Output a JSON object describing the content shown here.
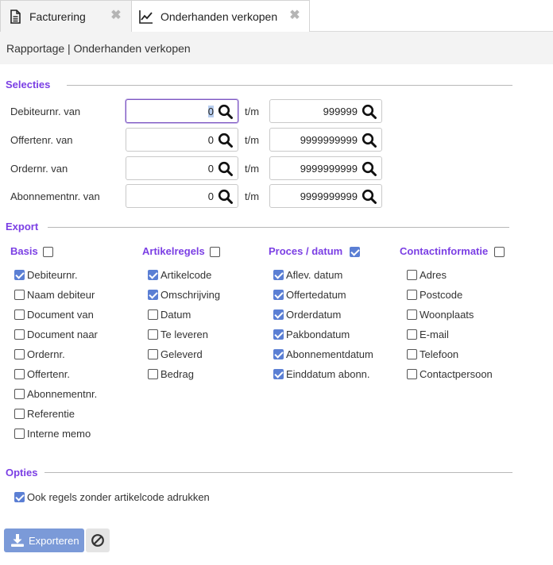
{
  "tabs": [
    {
      "label": "Facturering",
      "icon": "document-icon",
      "active": false
    },
    {
      "label": "Onderhanden verkopen",
      "icon": "line-chart-icon",
      "active": true
    }
  ],
  "breadcrumb": "Rapportage | Onderhanden verkopen",
  "selecties": {
    "title": "Selecties",
    "tm_label": "t/m",
    "rows": [
      {
        "label": "Debiteurnr. van",
        "from": "0",
        "to": "999999"
      },
      {
        "label": "Offertenr. van",
        "from": "0",
        "to": "9999999999"
      },
      {
        "label": "Ordernr. van",
        "from": "0",
        "to": "9999999999"
      },
      {
        "label": "Abonnementnr. van",
        "from": "0",
        "to": "9999999999"
      }
    ]
  },
  "export": {
    "title": "Export",
    "groups": [
      {
        "title": "Basis",
        "checked": false,
        "items": [
          {
            "label": "Debiteurnr.",
            "checked": true
          },
          {
            "label": "Naam debiteur",
            "checked": false
          },
          {
            "label": "Document van",
            "checked": false
          },
          {
            "label": "Document naar",
            "checked": false
          },
          {
            "label": "Ordernr.",
            "checked": false
          },
          {
            "label": "Offertenr.",
            "checked": false
          },
          {
            "label": "Abonnementnr.",
            "checked": false
          },
          {
            "label": "Referentie",
            "checked": false
          },
          {
            "label": "Interne memo",
            "checked": false
          }
        ]
      },
      {
        "title": "Artikelregels",
        "checked": false,
        "items": [
          {
            "label": "Artikelcode",
            "checked": true
          },
          {
            "label": "Omschrijving",
            "checked": true
          },
          {
            "label": "Datum",
            "checked": false
          },
          {
            "label": "Te leveren",
            "checked": false
          },
          {
            "label": "Geleverd",
            "checked": false
          },
          {
            "label": "Bedrag",
            "checked": false
          }
        ]
      },
      {
        "title": "Proces / datum",
        "checked": true,
        "items": [
          {
            "label": "Aflev. datum",
            "checked": true
          },
          {
            "label": "Offertedatum",
            "checked": true
          },
          {
            "label": "Orderdatum",
            "checked": true
          },
          {
            "label": "Pakbondatum",
            "checked": true
          },
          {
            "label": "Abonnementdatum",
            "checked": true
          },
          {
            "label": "Einddatum abonn.",
            "checked": true
          }
        ]
      },
      {
        "title": "Contactinformatie",
        "checked": false,
        "items": [
          {
            "label": "Adres",
            "checked": false
          },
          {
            "label": "Postcode",
            "checked": false
          },
          {
            "label": "Woonplaats",
            "checked": false
          },
          {
            "label": "E-mail",
            "checked": false
          },
          {
            "label": "Telefoon",
            "checked": false
          },
          {
            "label": "Contactpersoon",
            "checked": false
          }
        ]
      }
    ]
  },
  "opties": {
    "title": "Opties",
    "items": [
      {
        "label": "Ook regels zonder artikelcode adrukken",
        "checked": true
      }
    ]
  },
  "buttons": {
    "export_label": "Exporteren",
    "export_icon": "download-icon",
    "cancel_icon": "ban-icon"
  },
  "colors": {
    "accent": "#7b3fe4",
    "checkbox": "#5b7fd4",
    "primary_button": "#7b9ad8"
  }
}
